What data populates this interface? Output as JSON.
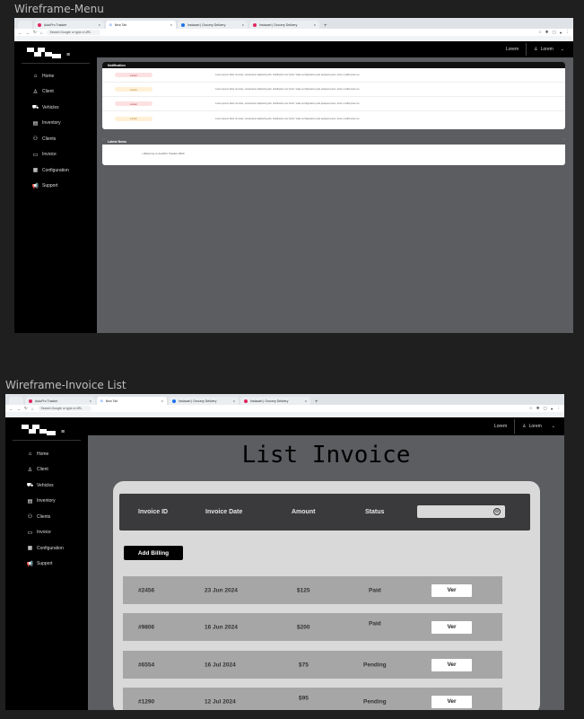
{
  "frames": [
    {
      "title": "Wireframe-Menu",
      "browser": {
        "tabs": [
          {
            "label": ""
          },
          {
            "label": "AutoPro Tracker"
          },
          {
            "label": "New Tab"
          },
          {
            "label": "Instacart | Grocery Delivery"
          },
          {
            "label": "Instacart | Grocery Delivery"
          }
        ],
        "address": "Search Google or type a URL"
      },
      "topbar": {
        "link": "Lorem",
        "user": "Lorem"
      },
      "menu": [
        "Home",
        "Client",
        "Vehicles",
        "Inventory",
        "Clients",
        "Invoice",
        "Configuration",
        "Support"
      ],
      "notifications": {
        "header": "Notification",
        "items": [
          {
            "badge": "Lorem",
            "text": "Lorem ipsum dolor sit amet, consectetur adipiscing elit. Vestibulum nec tortor. Vitae vel dignissim justo quisque ipsum, lorem mollis ipsum et."
          },
          {
            "badge": "Lorem",
            "text": "Lorem ipsum dolor sit amet, consectetur adipiscing elit. Vestibulum nec tortor. Vitae vel dignissim justo quisque ipsum, lorem mollis ipsum et."
          },
          {
            "badge": "Lorem",
            "text": "Lorem ipsum dolor sit amet, consectetur adipiscing elit. Vestibulum nec tortor. Vitae vel dignissim justo quisque ipsum, lorem mollis ipsum et."
          },
          {
            "badge": "Lorem",
            "text": "Lorem ipsum dolor sit amet, consectetur adipiscing elit. Vestibulum nec tortor. Vitae vel dignissim justo quisque ipsum, lorem mollis ipsum et."
          }
        ]
      },
      "news": {
        "header": "Latest News",
        "item": "• Welcome to AutoPro Tracker 2024"
      }
    },
    {
      "title": "Wireframe-Invoice List",
      "browser": {
        "tabs": [
          {
            "label": ""
          },
          {
            "label": "AutoPro Tracker"
          },
          {
            "label": "New Tab"
          },
          {
            "label": "Instacart | Grocery Delivery"
          },
          {
            "label": "Instacart | Grocery Delivery"
          }
        ],
        "address": "Search Google or type a URL"
      },
      "topbar": {
        "link": "Lorem",
        "user": "Lorem"
      },
      "menu": [
        "Home",
        "Client",
        "Vehicles",
        "Inventory",
        "Clients",
        "Invoice",
        "Configuration",
        "Support"
      ],
      "page_title": "List Invoice",
      "columns": [
        "Invoice ID",
        "Invoice  Date",
        "Amount",
        "Status"
      ],
      "search": {
        "placeholder": ""
      },
      "add_button": "Add Billing",
      "rows": [
        {
          "id": "#2456",
          "date": "23 Jun 2024",
          "amount": "$125",
          "status": "Paid",
          "action": "Ver"
        },
        {
          "id": "#9806",
          "date": "16 Jun 2024",
          "amount": "$200",
          "status": "Paid",
          "action": "Ver"
        },
        {
          "id": "#6554",
          "date": "16 Jul 2024",
          "amount": "$75",
          "status": "Pending",
          "action": "Ver"
        },
        {
          "id": "#1290",
          "date": "12 Jul 2024",
          "amount": "$95",
          "status": "Pending",
          "action": "Ver"
        }
      ]
    }
  ],
  "icons": [
    "home-icon",
    "user-icon",
    "car-icon",
    "inventory-icon",
    "clients-icon",
    "folder-icon",
    "document-icon",
    "megaphone-icon",
    "hamburger-icon",
    "chevron-down-icon",
    "search-icon"
  ],
  "colors": {
    "sidebar": "#000000",
    "content": "#5b5d61",
    "panel": "#d9d9d9",
    "row": "#a6a6a6",
    "header": "#3a3a3c"
  }
}
